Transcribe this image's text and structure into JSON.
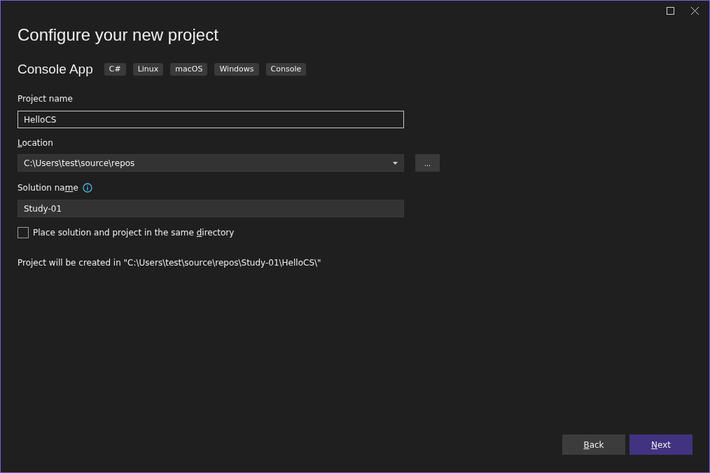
{
  "window": {
    "title": "Configure your new project"
  },
  "template": {
    "name": "Console App",
    "tags": [
      "C#",
      "Linux",
      "macOS",
      "Windows",
      "Console"
    ]
  },
  "project_name": {
    "label_parts": {
      "pre": "Project name"
    },
    "value": "HelloCS",
    "focused": true
  },
  "location": {
    "label_parts": {
      "key": "L",
      "post": "ocation"
    },
    "value": "C:\\Users\\test\\source\\repos",
    "browse": "..."
  },
  "solution_name": {
    "label_parts": {
      "pre": "Solution na",
      "key": "m",
      "post": "e"
    },
    "value": "Study-01"
  },
  "same_directory": {
    "label_parts": {
      "pre": "Place solution and project in the same ",
      "key": "d",
      "post": "irectory"
    },
    "checked": false
  },
  "result_path": "Project will be created in \"C:\\Users\\test\\source\\repos\\Study-01\\HelloCS\\\"",
  "buttons": [
    {
      "label_parts": {
        "key": "B",
        "post": "ack"
      },
      "kind": "secondary"
    },
    {
      "label_parts": {
        "key": "N",
        "post": "ext"
      },
      "kind": "primary"
    }
  ]
}
